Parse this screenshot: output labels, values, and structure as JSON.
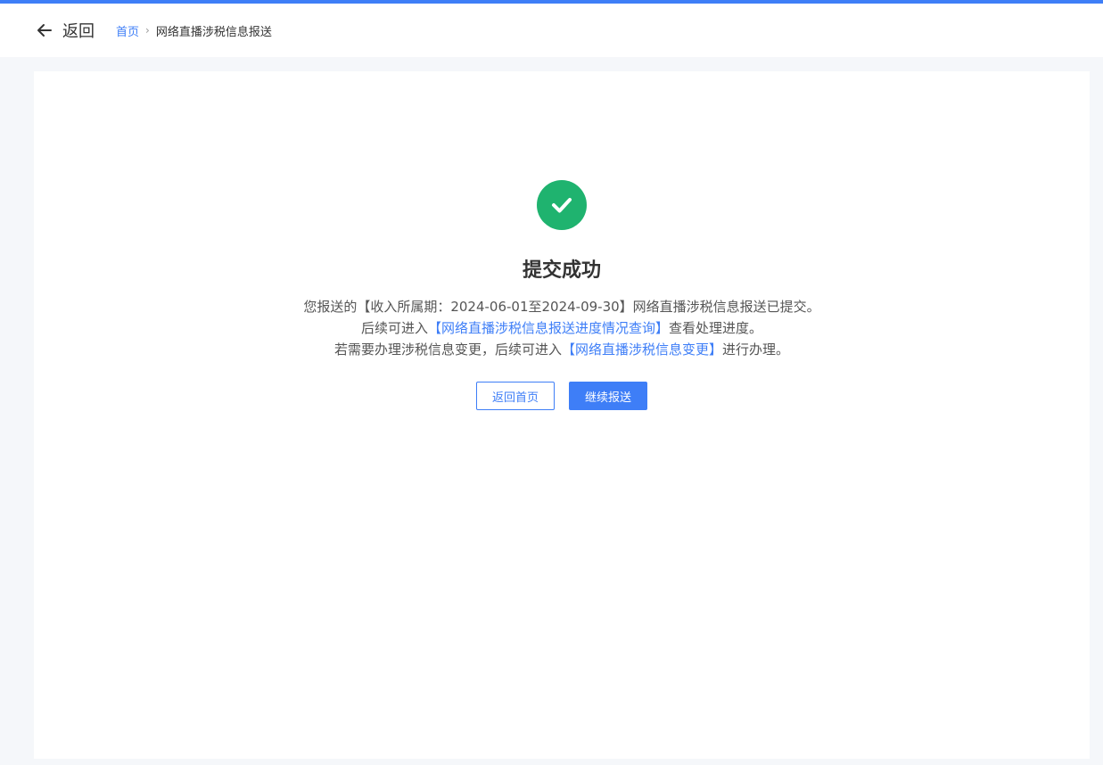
{
  "header": {
    "back_label": "返回",
    "breadcrumb": {
      "home": "首页",
      "separator": "›",
      "current": "网络直播涉税信息报送"
    }
  },
  "result": {
    "icon": "check-circle-icon",
    "title": "提交成功",
    "line1": "您报送的【收入所属期：2024-06-01至2024-09-30】网络直播涉税信息报送已提交。",
    "line2_prefix": "后续可进入",
    "line2_link": "【网络直播涉税信息报送进度情况查询】",
    "line2_suffix": "查看处理进度。",
    "line3_prefix": "若需要办理涉税信息变更，后续可进入",
    "line3_link": "【网络直播涉税信息变更】",
    "line3_suffix": "进行办理。"
  },
  "buttons": {
    "home": "返回首页",
    "continue": "继续报送"
  },
  "colors": {
    "accent": "#3e7ef7",
    "success": "#1fb36f"
  }
}
